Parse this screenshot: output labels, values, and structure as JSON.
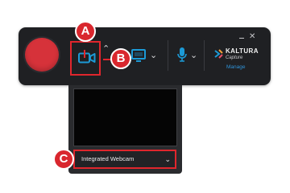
{
  "toolbar": {
    "record_button": "record",
    "camera_icon": "video-camera-icon",
    "screen_icon": "monitor-icon",
    "mic_icon": "microphone-icon",
    "brand_name": "KALTURA",
    "brand_sub": "Capture",
    "manage_label": "Manage",
    "minimize_icon": "minimize-icon",
    "close_icon": "close-icon",
    "close_glyph": "✕"
  },
  "webcam": {
    "selected": "Integrated Webcam",
    "chevron": "⌄"
  },
  "callouts": {
    "a": "A",
    "b": "B",
    "c": "C"
  },
  "colors": {
    "toolbar_bg": "#1f2023",
    "record": "#d6323a",
    "accent_teal": "#1c9ad6",
    "highlight_red": "#e0262d",
    "manage_blue": "#2f92d7"
  }
}
